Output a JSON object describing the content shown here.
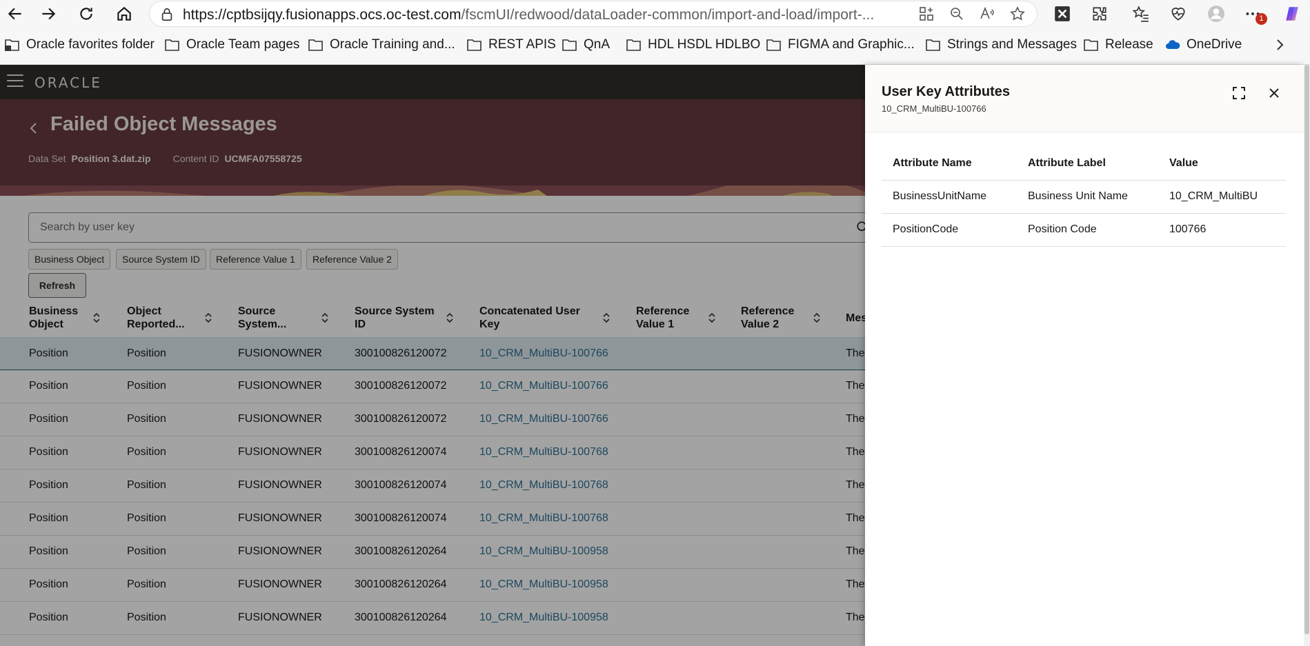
{
  "browser": {
    "url_prefix": "https://cptbsijqy.fusionapps.ocs.oc-test.com",
    "url_path": "/fscmUI/redwood/dataLoader-common/import-and-load/import-...",
    "notification_count": "1"
  },
  "favorites": [
    {
      "label": "Oracle favorites folder",
      "icon": "folder-briefcase-icon"
    },
    {
      "label": "Oracle Team pages",
      "icon": "folder-icon"
    },
    {
      "label": "Oracle Training and...",
      "icon": "folder-icon"
    },
    {
      "label": "REST APIS",
      "icon": "folder-icon"
    },
    {
      "label": "QnA",
      "icon": "folder-icon"
    },
    {
      "label": "HDL HSDL HDLBO",
      "icon": "folder-icon"
    },
    {
      "label": "FIGMA and Graphic...",
      "icon": "folder-icon"
    },
    {
      "label": "Strings and Messages",
      "icon": "folder-icon"
    },
    {
      "label": "Release",
      "icon": "folder-icon"
    },
    {
      "label": "OneDrive",
      "icon": "cloud-icon"
    }
  ],
  "app": {
    "logo": "ORACLE"
  },
  "page": {
    "title": "Failed Object Messages",
    "dataset_label": "Data Set",
    "dataset_value": "Position 3.dat.zip",
    "content_label": "Content ID",
    "content_value": "UCMFA07558725"
  },
  "search": {
    "placeholder": "Search by user key"
  },
  "filters": [
    "Business Object",
    "Source System ID",
    "Reference Value 1",
    "Reference Value 2"
  ],
  "refresh_label": "Refresh",
  "table": {
    "columns": [
      {
        "line1": "Business",
        "line2": "Object"
      },
      {
        "line1": "Object",
        "line2": "Reported..."
      },
      {
        "line1": "Source",
        "line2": "System..."
      },
      {
        "line1": "Source System",
        "line2": "ID"
      },
      {
        "line1": "Concatenated User",
        "line2": "Key"
      },
      {
        "line1": "Reference",
        "line2": "Value 1"
      },
      {
        "line1": "Reference",
        "line2": "Value 2"
      },
      {
        "line1": "Mes",
        "line2": ""
      }
    ],
    "rows": [
      {
        "bo": "Position",
        "reported": "Position",
        "source": "FUSIONOWNER",
        "ssid": "300100826120072",
        "key": "10_CRM_MultiBU-100766",
        "msg": "The"
      },
      {
        "bo": "Position",
        "reported": "Position",
        "source": "FUSIONOWNER",
        "ssid": "300100826120072",
        "key": "10_CRM_MultiBU-100766",
        "msg": "The"
      },
      {
        "bo": "Position",
        "reported": "Position",
        "source": "FUSIONOWNER",
        "ssid": "300100826120072",
        "key": "10_CRM_MultiBU-100766",
        "msg": "The"
      },
      {
        "bo": "Position",
        "reported": "Position",
        "source": "FUSIONOWNER",
        "ssid": "300100826120074",
        "key": "10_CRM_MultiBU-100768",
        "msg": "The"
      },
      {
        "bo": "Position",
        "reported": "Position",
        "source": "FUSIONOWNER",
        "ssid": "300100826120074",
        "key": "10_CRM_MultiBU-100768",
        "msg": "The"
      },
      {
        "bo": "Position",
        "reported": "Position",
        "source": "FUSIONOWNER",
        "ssid": "300100826120074",
        "key": "10_CRM_MultiBU-100768",
        "msg": "The"
      },
      {
        "bo": "Position",
        "reported": "Position",
        "source": "FUSIONOWNER",
        "ssid": "300100826120264",
        "key": "10_CRM_MultiBU-100958",
        "msg": "The"
      },
      {
        "bo": "Position",
        "reported": "Position",
        "source": "FUSIONOWNER",
        "ssid": "300100826120264",
        "key": "10_CRM_MultiBU-100958",
        "msg": "The"
      },
      {
        "bo": "Position",
        "reported": "Position",
        "source": "FUSIONOWNER",
        "ssid": "300100826120264",
        "key": "10_CRM_MultiBU-100958",
        "msg": "The"
      }
    ]
  },
  "drawer": {
    "title": "User Key Attributes",
    "subtitle": "10_CRM_MultiBU-100766",
    "columns": [
      "Attribute Name",
      "Attribute Label",
      "Value"
    ],
    "rows": [
      [
        "BusinessUnitName",
        "Business Unit Name",
        "10_CRM_MultiBU"
      ],
      [
        "PositionCode",
        "Position Code",
        "100766"
      ]
    ]
  },
  "colors": {
    "header": "#312d2a",
    "banner": "#663a40",
    "link": "#2d6f93",
    "selected_row": "#dfebef"
  }
}
